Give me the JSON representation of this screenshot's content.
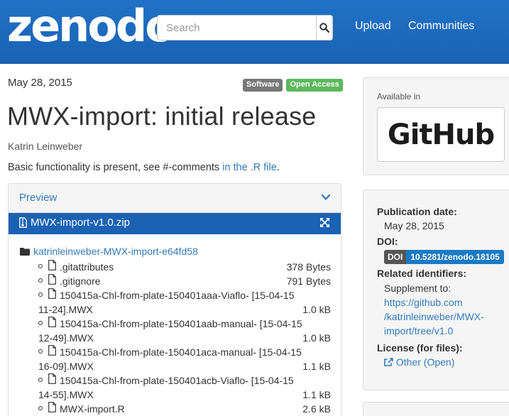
{
  "header": {
    "logo": "zenodo",
    "search_placeholder": "Search",
    "nav": [
      "Upload",
      "Communities"
    ]
  },
  "record": {
    "date": "May 28, 2015",
    "badges": [
      "Software",
      "Open Access"
    ],
    "title": "MWX-import: initial release",
    "author": "Katrin Leinweber",
    "description_prefix": "Basic functionality is present, see #-comments ",
    "description_link": "in the .R file",
    "description_suffix": "."
  },
  "preview": {
    "title": "Preview",
    "zip_name": "MWX-import-v1.0.zip",
    "folder": "katrinleinweber-MWX-import-e64fd58",
    "files": [
      {
        "name": ".gitattributes",
        "size": "378 Bytes"
      },
      {
        "name": ".gitignore",
        "size": "791 Bytes"
      },
      {
        "name": "150415a-Chl-from-plate-150401aaa-Viaflo- [15-04-15",
        "name2": "11-24].MWX",
        "size": "1.0 kB"
      },
      {
        "name": "150415a-Chl-from-plate-150401aab-manual- [15-04-15",
        "name2": "12-49].MWX",
        "size": "1.0 kB"
      },
      {
        "name": "150415a-Chl-from-plate-150401aca-manual- [15-04-15",
        "name2": "16-09].MWX",
        "size": "1.1 kB"
      },
      {
        "name": "150415a-Chl-from-plate-150401acb-Viaflo- [15-04-15",
        "name2": "14-55].MWX",
        "size": "1.1 kB"
      },
      {
        "name": "MWX-import.R",
        "size": "2.6 kB"
      }
    ]
  },
  "sidebar": {
    "available_in": "Available in",
    "github_text": "GitHub",
    "publication_date_label": "Publication date:",
    "publication_date": "May 28, 2015",
    "doi_label": "DOI:",
    "doi_prefix": "DOI",
    "doi_value": "10.5281/zenodo.18105",
    "related_label": "Related identifiers:",
    "related_type": "Supplement to:",
    "related_link_1": "https://github.com",
    "related_link_2": "/katrinleinweber/MWX-",
    "related_link_3": "import/tree/v1.0",
    "license_label": "License (for files):",
    "license_value": "Other (Open)"
  }
}
